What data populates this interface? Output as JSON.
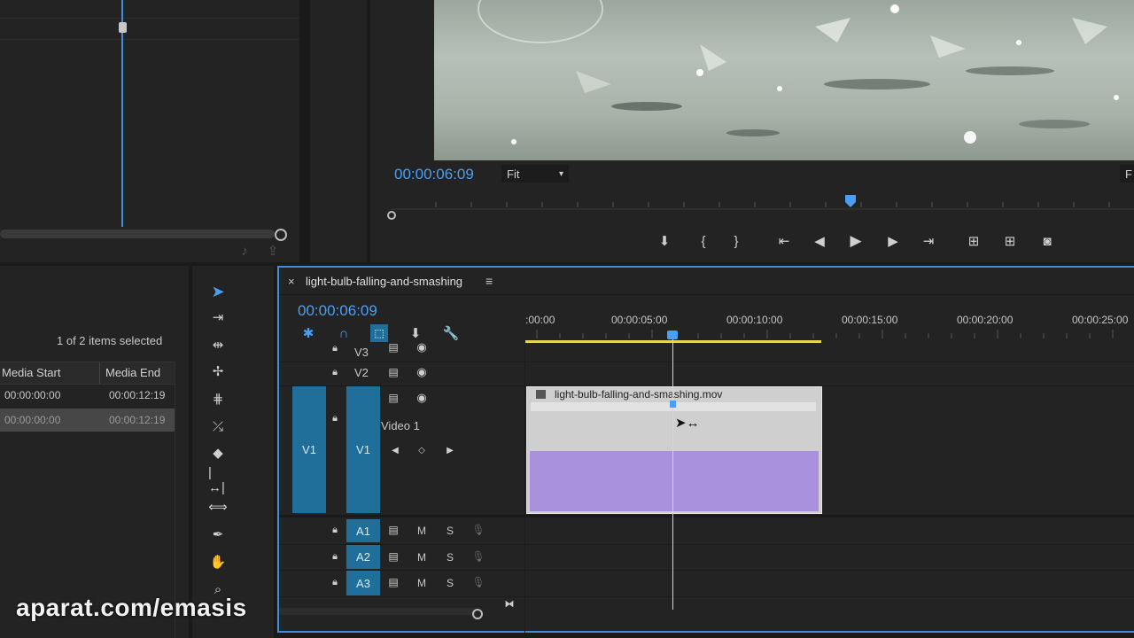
{
  "source_monitor": {},
  "program_monitor": {
    "timecode": "00:00:06:09",
    "fit_label": "Fit",
    "right_cut_label": "F"
  },
  "project_panel": {
    "selection_status": "1 of 2 items selected",
    "columns": [
      "Media Start",
      "Media End"
    ],
    "rows": [
      {
        "start": "00:00:00:00",
        "end": "00:00:12:19"
      },
      {
        "start": "00:00:00:00",
        "end": "00:00:12:19"
      }
    ]
  },
  "timeline": {
    "sequence_tab": "light-bulb-falling-and-smashing",
    "close_glyph": "×",
    "menu_glyph": "≡",
    "timecode": "00:00:06:09",
    "ruler_labels": [
      ":00:00",
      "00:00:05:00",
      "00:00:10:00",
      "00:00:15:00",
      "00:00:20:00",
      "00:00:25:00"
    ],
    "video_tracks": {
      "v3": "V3",
      "v2": "V2",
      "v1": "V1",
      "v1_source": "V1",
      "v1_name": "Video 1"
    },
    "audio_tracks": [
      {
        "label": "A1",
        "m": "M",
        "s": "S"
      },
      {
        "label": "A2",
        "m": "M",
        "s": "S"
      },
      {
        "label": "A3",
        "m": "M",
        "s": "S"
      }
    ],
    "clip_name": "light-bulb-falling-and-smashing.mov"
  },
  "watermark": "aparat.com/emasis",
  "colors": {
    "accent": "#4a9ff5",
    "track_blue": "#1f6f9a",
    "clip_purple": "#a991dd",
    "work_area": "#e8d45a"
  }
}
